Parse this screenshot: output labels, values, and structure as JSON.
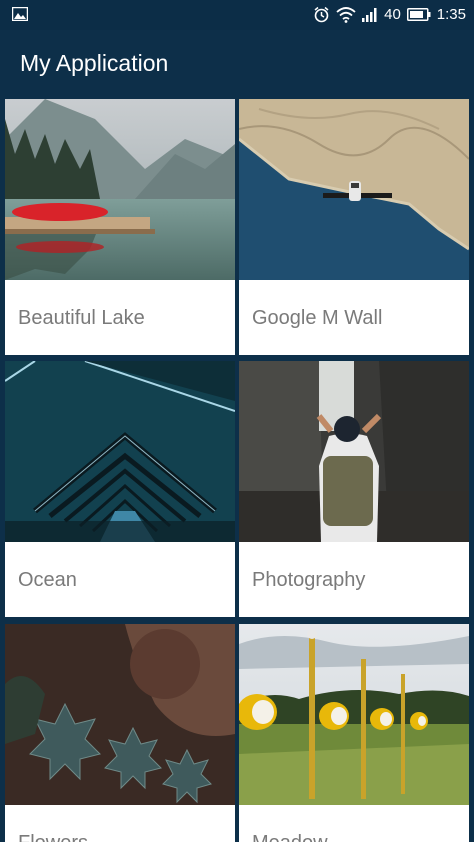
{
  "status_bar": {
    "signal_text": "40",
    "time": "1:35"
  },
  "app_bar": {
    "title": "My Application"
  },
  "cards": [
    {
      "label": "Beautiful Lake"
    },
    {
      "label": "Google M Wall"
    },
    {
      "label": "Ocean"
    },
    {
      "label": "Photography"
    },
    {
      "label": "Flowers"
    },
    {
      "label": "Meadow"
    }
  ]
}
